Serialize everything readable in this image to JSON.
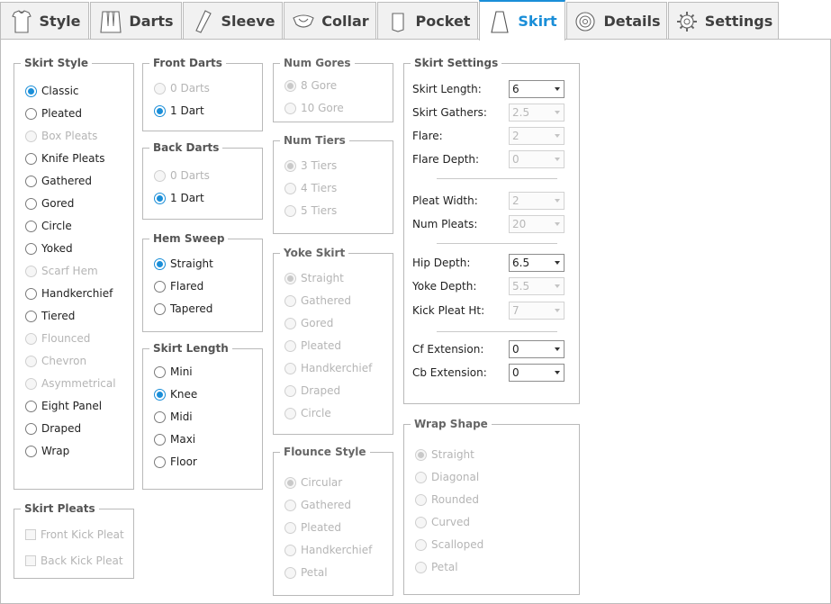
{
  "tabs": [
    {
      "label": "Style",
      "icon": "shirt-icon",
      "active": false
    },
    {
      "label": "Darts",
      "icon": "darts-icon",
      "active": false
    },
    {
      "label": "Sleeve",
      "icon": "sleeve-icon",
      "active": false
    },
    {
      "label": "Collar",
      "icon": "collar-icon",
      "active": false
    },
    {
      "label": "Pocket",
      "icon": "pocket-icon",
      "active": false
    },
    {
      "label": "Skirt",
      "icon": "skirt-icon",
      "active": true
    },
    {
      "label": "Details",
      "icon": "details-icon",
      "active": false
    },
    {
      "label": "Settings",
      "icon": "gear-icon",
      "active": false
    }
  ],
  "colors": {
    "accent": "#1a8ed8",
    "border": "#bcbcbc",
    "disabled_text": "#b5b5b5"
  },
  "skirt_style": {
    "title": "Skirt Style",
    "options": [
      {
        "label": "Classic",
        "selected": true,
        "enabled": true
      },
      {
        "label": "Pleated",
        "selected": false,
        "enabled": true
      },
      {
        "label": "Box Pleats",
        "selected": false,
        "enabled": false
      },
      {
        "label": "Knife Pleats",
        "selected": false,
        "enabled": true
      },
      {
        "label": "Gathered",
        "selected": false,
        "enabled": true
      },
      {
        "label": "Gored",
        "selected": false,
        "enabled": true
      },
      {
        "label": "Circle",
        "selected": false,
        "enabled": true
      },
      {
        "label": "Yoked",
        "selected": false,
        "enabled": true
      },
      {
        "label": "Scarf Hem",
        "selected": false,
        "enabled": false
      },
      {
        "label": "Handkerchief",
        "selected": false,
        "enabled": true
      },
      {
        "label": "Tiered",
        "selected": false,
        "enabled": true
      },
      {
        "label": "Flounced",
        "selected": false,
        "enabled": false
      },
      {
        "label": "Chevron",
        "selected": false,
        "enabled": false
      },
      {
        "label": "Asymmetrical",
        "selected": false,
        "enabled": false
      },
      {
        "label": "Eight Panel",
        "selected": false,
        "enabled": true
      },
      {
        "label": "Draped",
        "selected": false,
        "enabled": true
      },
      {
        "label": "Wrap",
        "selected": false,
        "enabled": true
      }
    ]
  },
  "skirt_pleats": {
    "title": "Skirt Pleats",
    "options": [
      {
        "label": "Front Kick Pleat",
        "checked": false,
        "enabled": false
      },
      {
        "label": "Back Kick Pleat",
        "checked": false,
        "enabled": false
      }
    ]
  },
  "front_darts": {
    "title": "Front Darts",
    "options": [
      {
        "label": "0 Darts",
        "selected": false,
        "enabled": false
      },
      {
        "label": "1 Dart",
        "selected": true,
        "enabled": true
      }
    ]
  },
  "back_darts": {
    "title": "Back Darts",
    "options": [
      {
        "label": "0 Darts",
        "selected": false,
        "enabled": false
      },
      {
        "label": "1 Dart",
        "selected": true,
        "enabled": true
      }
    ]
  },
  "hem_sweep": {
    "title": "Hem Sweep",
    "options": [
      {
        "label": "Straight",
        "selected": true,
        "enabled": true
      },
      {
        "label": "Flared",
        "selected": false,
        "enabled": true
      },
      {
        "label": "Tapered",
        "selected": false,
        "enabled": true
      }
    ]
  },
  "skirt_length": {
    "title": "Skirt Length",
    "options": [
      {
        "label": "Mini",
        "selected": false,
        "enabled": true
      },
      {
        "label": "Knee",
        "selected": true,
        "enabled": true
      },
      {
        "label": "Midi",
        "selected": false,
        "enabled": true
      },
      {
        "label": "Maxi",
        "selected": false,
        "enabled": true
      },
      {
        "label": "Floor",
        "selected": false,
        "enabled": true
      }
    ]
  },
  "num_gores": {
    "title": "Num Gores",
    "options": [
      {
        "label": "8 Gore",
        "selected": true,
        "enabled": false
      },
      {
        "label": "10 Gore",
        "selected": false,
        "enabled": false
      }
    ]
  },
  "num_tiers": {
    "title": "Num Tiers",
    "options": [
      {
        "label": "3 Tiers",
        "selected": true,
        "enabled": false
      },
      {
        "label": "4 Tiers",
        "selected": false,
        "enabled": false
      },
      {
        "label": "5 Tiers",
        "selected": false,
        "enabled": false
      }
    ]
  },
  "yoke_skirt": {
    "title": "Yoke Skirt",
    "options": [
      {
        "label": "Straight",
        "selected": true,
        "enabled": false
      },
      {
        "label": "Gathered",
        "selected": false,
        "enabled": false
      },
      {
        "label": "Gored",
        "selected": false,
        "enabled": false
      },
      {
        "label": "Pleated",
        "selected": false,
        "enabled": false
      },
      {
        "label": "Handkerchief",
        "selected": false,
        "enabled": false
      },
      {
        "label": "Draped",
        "selected": false,
        "enabled": false
      },
      {
        "label": "Circle",
        "selected": false,
        "enabled": false
      }
    ]
  },
  "flounce_style": {
    "title": "Flounce Style",
    "options": [
      {
        "label": "Circular",
        "selected": true,
        "enabled": false
      },
      {
        "label": "Gathered",
        "selected": false,
        "enabled": false
      },
      {
        "label": "Pleated",
        "selected": false,
        "enabled": false
      },
      {
        "label": "Handkerchief",
        "selected": false,
        "enabled": false
      },
      {
        "label": "Petal",
        "selected": false,
        "enabled": false
      }
    ]
  },
  "skirt_settings": {
    "title": "Skirt Settings",
    "rows": [
      {
        "label": "Skirt Length:",
        "value": "6",
        "enabled": true
      },
      {
        "label": "Skirt Gathers:",
        "value": "2.5",
        "enabled": false
      },
      {
        "label": "Flare:",
        "value": "2",
        "enabled": false
      },
      {
        "label": "Flare Depth:",
        "value": "0",
        "enabled": false
      },
      {
        "label": "Pleat Width:",
        "value": "2",
        "enabled": false
      },
      {
        "label": "Num Pleats:",
        "value": "20",
        "enabled": false
      },
      {
        "label": "Hip Depth:",
        "value": "6.5",
        "enabled": true
      },
      {
        "label": "Yoke Depth:",
        "value": "5.5",
        "enabled": false
      },
      {
        "label": "Kick Pleat Ht:",
        "value": "7",
        "enabled": false
      },
      {
        "label": "Cf Extension:",
        "value": "0",
        "enabled": true
      },
      {
        "label": "Cb Extension:",
        "value": "0",
        "enabled": true
      }
    ]
  },
  "wrap_shape": {
    "title": "Wrap Shape",
    "options": [
      {
        "label": "Straight",
        "selected": true,
        "enabled": false
      },
      {
        "label": "Diagonal",
        "selected": false,
        "enabled": false
      },
      {
        "label": "Rounded",
        "selected": false,
        "enabled": false
      },
      {
        "label": "Curved",
        "selected": false,
        "enabled": false
      },
      {
        "label": "Scalloped",
        "selected": false,
        "enabled": false
      },
      {
        "label": "Petal",
        "selected": false,
        "enabled": false
      }
    ]
  }
}
